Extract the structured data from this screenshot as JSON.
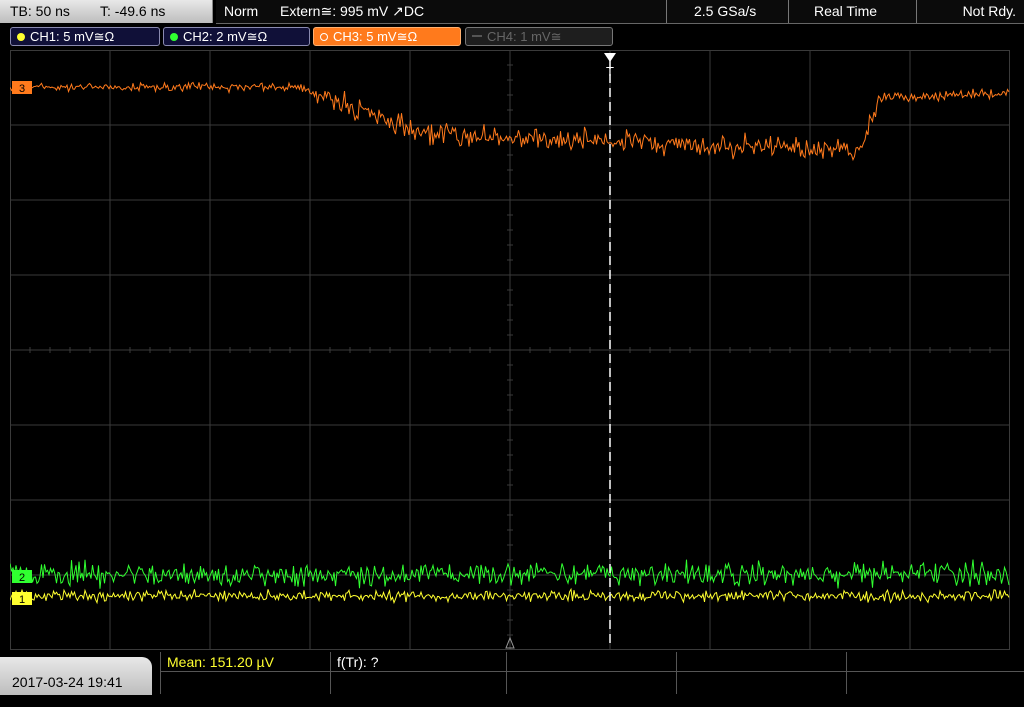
{
  "timebase": {
    "tb": "TB: 50 ns",
    "trigger_time": "T: -49.6 ns"
  },
  "status_bar": {
    "mode": "Norm",
    "trigger_source": "Extern≅: 995 mV ↗DC",
    "sample_rate": "2.5 GSa/s",
    "acq_mode": "Real Time",
    "state": "Not Rdy."
  },
  "channels": [
    {
      "label": "CH1: 5 mV≅Ω",
      "color": "#ffff30",
      "active": false
    },
    {
      "label": "CH2: 2 mV≅Ω",
      "color": "#30ff30",
      "active": false
    },
    {
      "label": "CH3: 5 mV≅Ω",
      "color": "#ff7a1c",
      "active": true
    },
    {
      "label": "CH4: 1 mV≅",
      "color": "#666666",
      "active": false
    }
  ],
  "markers": {
    "trigger_marker": "T",
    "ch1_marker": "1",
    "ch2_marker": "2",
    "ch3_marker": "3"
  },
  "bottom": {
    "date": "2017-03-24 19:41",
    "measurement1": "Mean: 151.20 µV",
    "measurement2": "f(Tr): ?"
  },
  "colors": {
    "grid": "#3a3a3a",
    "ch1": "#ffff30",
    "ch2": "#30ff30",
    "ch3": "#ff7a1c",
    "trigger_line": "#ffffff"
  }
}
